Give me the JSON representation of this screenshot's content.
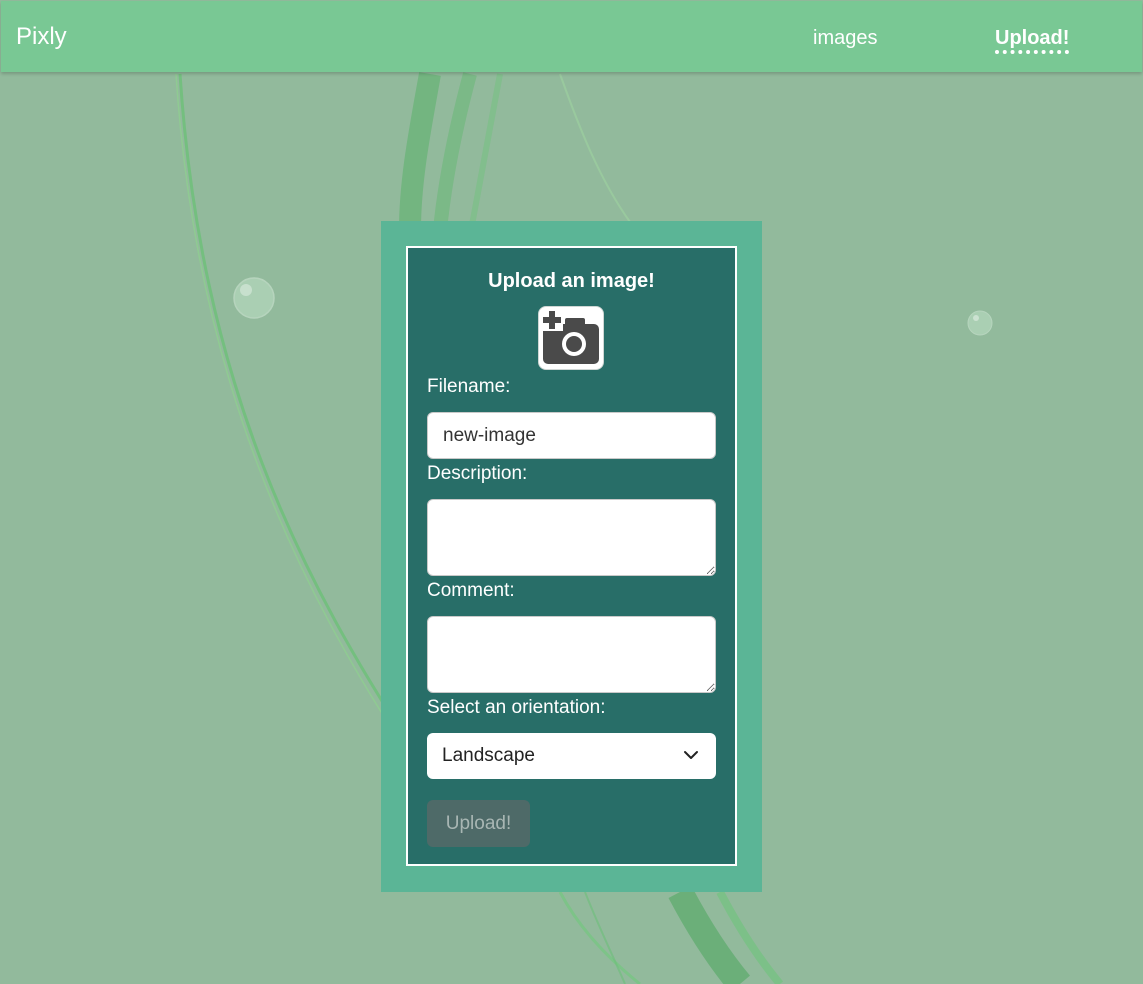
{
  "navbar": {
    "brand": "Pixly",
    "links": [
      {
        "label": "images"
      },
      {
        "label": "Upload!"
      }
    ]
  },
  "form": {
    "title": "Upload an image!",
    "camera_icon": "camera-add-icon",
    "filename": {
      "label": "Filename:",
      "value": "new-image"
    },
    "description": {
      "label": "Description:",
      "value": ""
    },
    "comment": {
      "label": "Comment:",
      "value": ""
    },
    "orientation": {
      "label": "Select an orientation:",
      "value": "Landscape"
    },
    "submit_label": "Upload!"
  },
  "colors": {
    "navbar": "#79c894",
    "background": "#92ba9c",
    "card_outer": "#5bb596",
    "card_inner": "#286e68",
    "submit_button": "#4e6a68"
  }
}
